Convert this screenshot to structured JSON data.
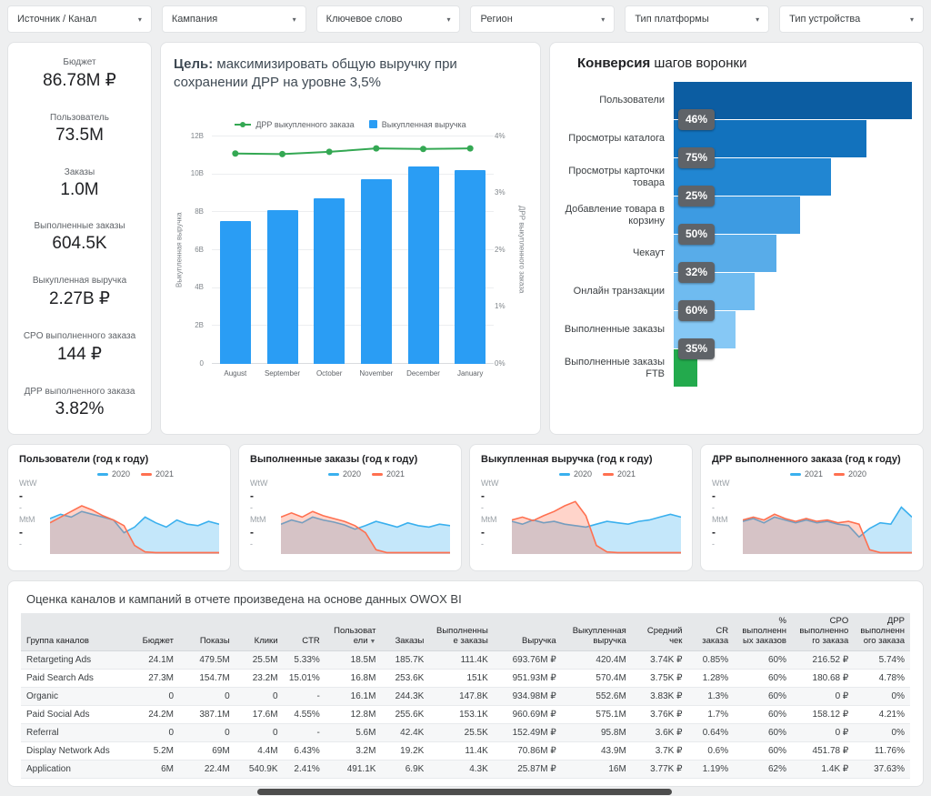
{
  "filters": [
    {
      "label": "Источник / Канал"
    },
    {
      "label": "Кампания"
    },
    {
      "label": "Ключевое слово"
    },
    {
      "label": "Регион"
    },
    {
      "label": "Тип платформы"
    },
    {
      "label": "Тип устройства"
    }
  ],
  "kpis": [
    {
      "label": "Бюджет",
      "value": "86.78M ₽"
    },
    {
      "label": "Пользователь",
      "value": "73.5M"
    },
    {
      "label": "Заказы",
      "value": "1.0M"
    },
    {
      "label": "Выполненные заказы",
      "value": "604.5K"
    },
    {
      "label": "Выкупленная выручка",
      "value": "2.27B ₽"
    },
    {
      "label": "CPO выполненного заказа",
      "value": "144 ₽"
    },
    {
      "label": "ДРР выполненного заказа",
      "value": "3.82%"
    }
  ],
  "goal": {
    "title_bold": "Цель:",
    "title_rest": " максимизировать общую выручку при сохранении ДРР на уровне 3,5%"
  },
  "funnel_header": {
    "title_bold": "Конверсия",
    "title_rest": " шагов воронки"
  },
  "chart_data": [
    {
      "type": "bar",
      "subtype": "combo-bar-line",
      "categories": [
        "August",
        "September",
        "October",
        "November",
        "December",
        "January"
      ],
      "series": [
        {
          "name": "Выкупленная выручка",
          "kind": "bar",
          "axis": "left",
          "values_billions": [
            7.5,
            8.1,
            8.7,
            9.7,
            10.4,
            10.2
          ]
        },
        {
          "name": "ДРР выкупленного заказа",
          "kind": "line",
          "axis": "right",
          "values_percent": [
            3.7,
            3.69,
            3.73,
            3.79,
            3.78,
            3.79
          ]
        }
      ],
      "left_axis": {
        "title": "Выкупленная выручка",
        "ticks": [
          "0",
          "2B",
          "4B",
          "6B",
          "8B",
          "10B",
          "12B"
        ],
        "max": 12
      },
      "right_axis": {
        "title": "ДРР выкупленного заказа",
        "ticks": [
          "0%",
          "1%",
          "2%",
          "3%",
          "4%"
        ],
        "max": 4
      },
      "grid": true,
      "legend_position": "top-center"
    },
    {
      "type": "funnel",
      "title": "Конверсия шагов воронки",
      "steps": [
        {
          "label": "Пользователи",
          "width_percent": 100
        },
        {
          "label": "Просмотры каталога",
          "width_percent": 81,
          "conversion_from_previous": "46%"
        },
        {
          "label": "Просмотры карточки товара",
          "width_percent": 66,
          "conversion_from_previous": "75%"
        },
        {
          "label": "Добавление товара в корзину",
          "width_percent": 53,
          "conversion_from_previous": "25%"
        },
        {
          "label": "Чекаут",
          "width_percent": 43,
          "conversion_from_previous": "50%"
        },
        {
          "label": "Онлайн транзакции",
          "width_percent": 34,
          "conversion_from_previous": "32%"
        },
        {
          "label": "Выполненные заказы",
          "width_percent": 26,
          "conversion_from_previous": "60%"
        },
        {
          "label": "Выполненные заказы FTB",
          "width_percent": 10,
          "conversion_from_previous": "35%"
        }
      ]
    },
    {
      "type": "area",
      "title": "Пользователи (год к году)",
      "row_labels": [
        {
          "label": "WtW",
          "value": "-",
          "sub": "-"
        },
        {
          "label": "MtM",
          "value": "-",
          "sub": "-"
        }
      ],
      "legend": [
        {
          "name": "2020",
          "color": "#3ab0ee"
        },
        {
          "name": "2021",
          "color": "#ff7050"
        }
      ],
      "series": [
        {
          "name": "2020",
          "color": "#3ab0ee",
          "values": [
            50,
            56,
            52,
            60,
            56,
            52,
            48,
            30,
            38,
            52,
            44,
            38,
            48,
            42,
            40,
            46,
            42
          ]
        },
        {
          "name": "2021",
          "color": "#ff7050",
          "values": [
            44,
            52,
            60,
            68,
            62,
            54,
            48,
            40,
            12,
            3,
            2,
            2,
            2,
            2,
            2,
            2,
            2
          ]
        }
      ]
    },
    {
      "type": "area",
      "title": "Выполненные заказы (год к году)",
      "row_labels": [
        {
          "label": "WtW",
          "value": "-",
          "sub": "-"
        },
        {
          "label": "MtM",
          "value": "-",
          "sub": "-"
        }
      ],
      "legend": [
        {
          "name": "2020",
          "color": "#3ab0ee"
        },
        {
          "name": "2021",
          "color": "#ff7050"
        }
      ],
      "series": [
        {
          "name": "2020",
          "color": "#3ab0ee",
          "values": [
            42,
            48,
            44,
            52,
            48,
            45,
            41,
            35,
            40,
            46,
            42,
            38,
            44,
            40,
            38,
            42,
            40
          ]
        },
        {
          "name": "2021",
          "color": "#ff7050",
          "values": [
            52,
            58,
            52,
            60,
            54,
            50,
            46,
            40,
            30,
            6,
            2,
            2,
            2,
            2,
            2,
            2,
            2
          ]
        }
      ]
    },
    {
      "type": "area",
      "title": "Выкупленная выручка (год к году)",
      "row_labels": [
        {
          "label": "WtW",
          "value": "-",
          "sub": "-"
        },
        {
          "label": "MtM",
          "value": "-",
          "sub": "-"
        }
      ],
      "legend": [
        {
          "name": "2020",
          "color": "#3ab0ee"
        },
        {
          "name": "2021",
          "color": "#ff7050"
        }
      ],
      "series": [
        {
          "name": "2020",
          "color": "#3ab0ee",
          "values": [
            46,
            42,
            48,
            44,
            46,
            42,
            40,
            38,
            42,
            46,
            44,
            42,
            46,
            48,
            52,
            56,
            52
          ]
        },
        {
          "name": "2021",
          "color": "#ff7050",
          "values": [
            48,
            52,
            47,
            54,
            60,
            68,
            74,
            54,
            12,
            3,
            2,
            2,
            2,
            2,
            2,
            2,
            2
          ]
        }
      ]
    },
    {
      "type": "area",
      "title": "ДРР выполненного заказа (год к году)",
      "row_labels": [
        {
          "label": "WtW",
          "value": "-",
          "sub": "-"
        },
        {
          "label": "MtM",
          "value": "-",
          "sub": "-"
        }
      ],
      "legend": [
        {
          "name": "2021",
          "color": "#3ab0ee"
        },
        {
          "name": "2020",
          "color": "#ff7050"
        }
      ],
      "series": [
        {
          "name": "2021",
          "color": "#3ab0ee",
          "values": [
            46,
            50,
            44,
            52,
            48,
            44,
            48,
            44,
            46,
            42,
            40,
            24,
            36,
            44,
            42,
            66,
            52
          ]
        },
        {
          "name": "2020",
          "color": "#ff7050",
          "values": [
            48,
            52,
            48,
            56,
            50,
            46,
            50,
            46,
            48,
            44,
            46,
            42,
            6,
            2,
            2,
            2,
            2
          ]
        }
      ]
    }
  ],
  "table": {
    "title": "Оценка каналов и кампаний в отчете произведена на основе данных OWOX BI",
    "headers": [
      "Группа каналов",
      "Бюджет",
      "Показы",
      "Клики",
      "CTR",
      "Пользователи",
      "Заказы",
      "Выполненные заказы",
      "Выручка",
      "Выкупленная выручка",
      "Средний чек",
      "CR заказа",
      "% выполненных заказов",
      "CPO выполненного заказа",
      "ДРР выполненного заказа"
    ],
    "sorted_column_index": 5,
    "rows": [
      [
        "Retargeting Ads",
        "24.1M",
        "479.5M",
        "25.5M",
        "5.33%",
        "18.5M",
        "185.7K",
        "111.4K",
        "693.76M ₽",
        "420.4M",
        "3.74K ₽",
        "0.85%",
        "60%",
        "216.52 ₽",
        "5.74%"
      ],
      [
        "Paid Search Ads",
        "27.3M",
        "154.7M",
        "23.2M",
        "15.01%",
        "16.8M",
        "253.6K",
        "151K",
        "951.93M ₽",
        "570.4M",
        "3.75K ₽",
        "1.28%",
        "60%",
        "180.68 ₽",
        "4.78%"
      ],
      [
        "Organic",
        "0",
        "0",
        "0",
        "-",
        "16.1M",
        "244.3K",
        "147.8K",
        "934.98M ₽",
        "552.6M",
        "3.83K ₽",
        "1.3%",
        "60%",
        "0 ₽",
        "0%"
      ],
      [
        "Paid Social Ads",
        "24.2M",
        "387.1M",
        "17.6M",
        "4.55%",
        "12.8M",
        "255.6K",
        "153.1K",
        "960.69M ₽",
        "575.1M",
        "3.76K ₽",
        "1.7%",
        "60%",
        "158.12 ₽",
        "4.21%"
      ],
      [
        "Referral",
        "0",
        "0",
        "0",
        "-",
        "5.6M",
        "42.4K",
        "25.5K",
        "152.49M ₽",
        "95.8M",
        "3.6K ₽",
        "0.64%",
        "60%",
        "0 ₽",
        "0%"
      ],
      [
        "Display Network Ads",
        "5.2M",
        "69M",
        "4.4M",
        "6.43%",
        "3.2M",
        "19.2K",
        "11.4K",
        "70.86M ₽",
        "43.9M",
        "3.7K ₽",
        "0.6%",
        "60%",
        "451.78 ₽",
        "11.76%"
      ],
      [
        "Application",
        "6M",
        "22.4M",
        "540.9K",
        "2.41%",
        "491.1K",
        "6.9K",
        "4.3K",
        "25.87M ₽",
        "16M",
        "3.77K ₽",
        "1.19%",
        "62%",
        "1.4K ₽",
        "37.63%"
      ]
    ]
  },
  "colors": {
    "bar_blue": "#2a9df4",
    "line_green": "#34a853",
    "funnel_steps": [
      "#0c5da2",
      "#1272bd",
      "#2186d2",
      "#3d9be2",
      "#58ace9",
      "#6fbbf0",
      "#86c8f5",
      "#23aa4d"
    ],
    "badge_bg": "#5f6368",
    "spark_blue": "#3ab0ee",
    "spark_orange": "#ff7050"
  }
}
